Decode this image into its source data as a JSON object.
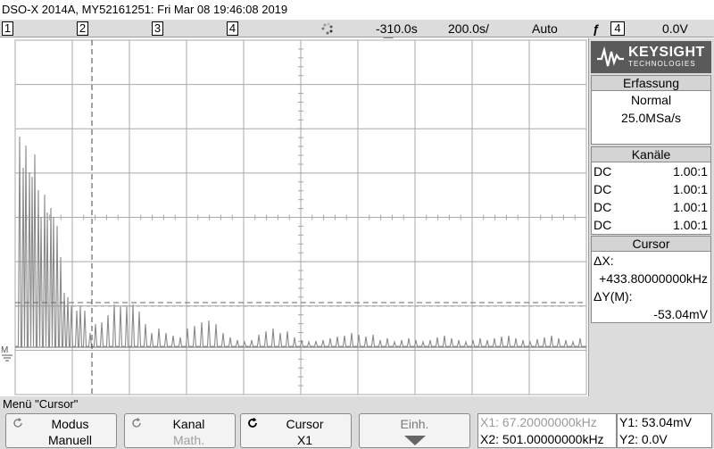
{
  "title": "DSO-X 2014A, MY52161251: Fri Mar 08 19:46:08 2019",
  "status": {
    "channels": [
      "1",
      "2",
      "3",
      "4"
    ],
    "time_offset": "-310.0s",
    "timebase": "200.0s/",
    "trigger_mode": "Auto",
    "trigger_source": "4",
    "trigger_level": "0.0V"
  },
  "brand": {
    "name": "KEYSIGHT",
    "sub": "TECHNOLOGIES"
  },
  "acquisition": {
    "header": "Erfassung",
    "mode": "Normal",
    "rate": "25.0MSa/s"
  },
  "channels_panel": {
    "header": "Kanäle",
    "rows": [
      {
        "coupling": "DC",
        "probe": "1.00:1"
      },
      {
        "coupling": "DC",
        "probe": "1.00:1"
      },
      {
        "coupling": "DC",
        "probe": "1.00:1"
      },
      {
        "coupling": "DC",
        "probe": "1.00:1"
      }
    ]
  },
  "cursor_panel": {
    "header": "Cursor",
    "dx_label": "ΔX:",
    "dx_value": "+433.80000000kHz",
    "dy_label": "ΔY(M):",
    "dy_value": "-53.04mV"
  },
  "menu": {
    "title": "Menü \"Cursor\"",
    "softkeys": [
      {
        "top": "Modus",
        "bottom": "Manuell"
      },
      {
        "top": "Kanal",
        "bottom": "Math."
      },
      {
        "top": "Cursor",
        "bottom": "X1"
      },
      {
        "top": "Einh.",
        "bottom": ""
      }
    ]
  },
  "readouts": {
    "x1": "X1: 67.20000000kHz",
    "x2": "X2: 501.00000000kHz",
    "y1": "Y1: 53.04mV",
    "y2": "Y2: 0.0V"
  },
  "colors": {
    "trace": "#8a8a8a",
    "grid": "#a8a8a8",
    "background": "#ffffff",
    "panel": "#dcdcdc"
  }
}
